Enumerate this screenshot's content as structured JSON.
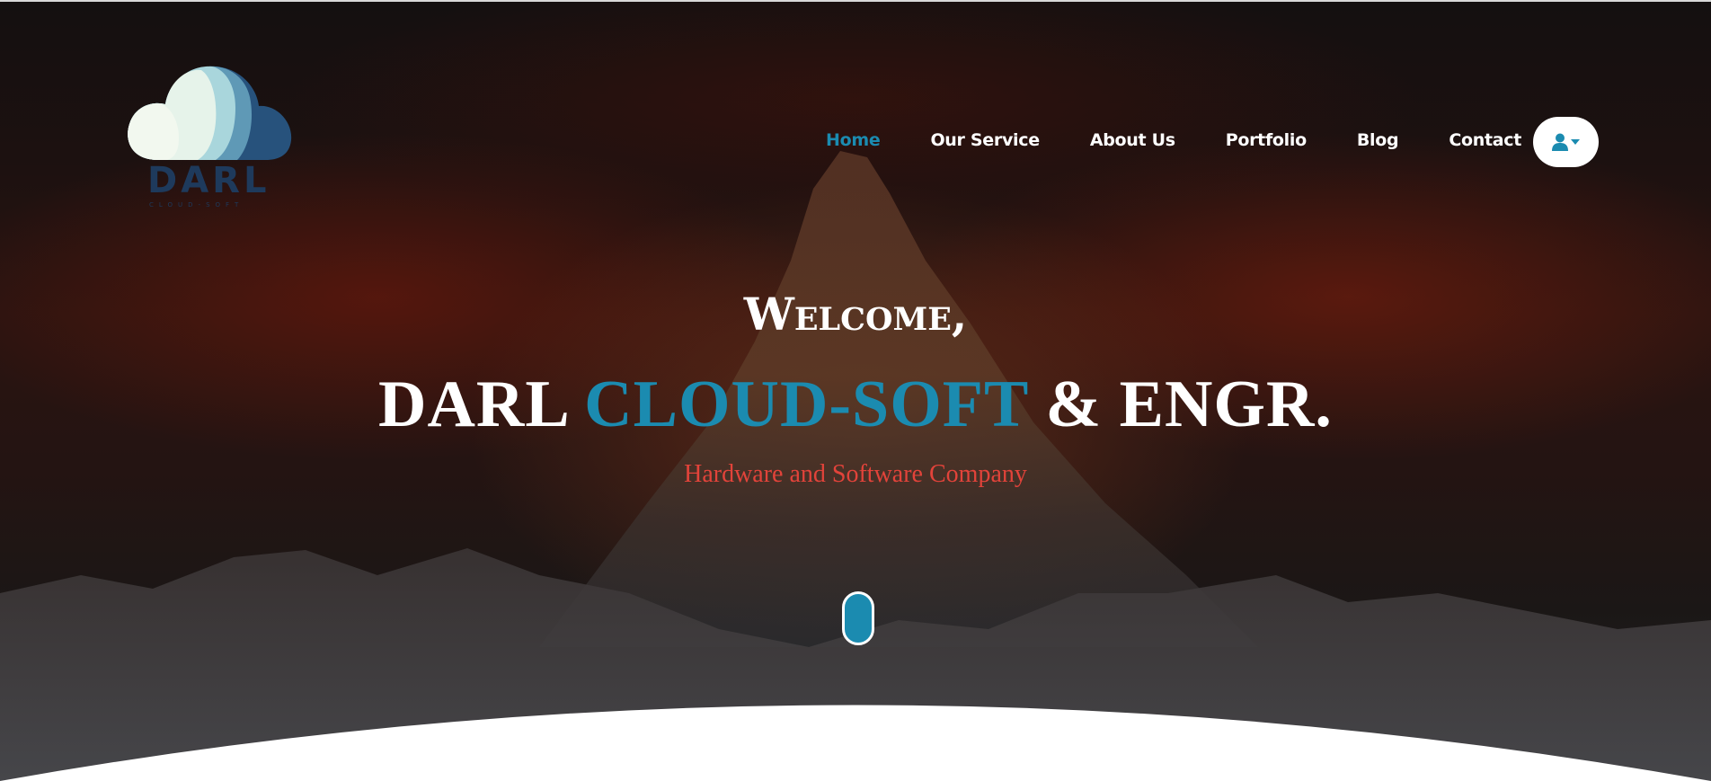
{
  "logo": {
    "word": "DARL",
    "subtitle": "CLOUD-SOFT"
  },
  "nav": {
    "items": [
      {
        "label": "Home",
        "active": true
      },
      {
        "label": "Our Service",
        "active": false
      },
      {
        "label": "About Us",
        "active": false
      },
      {
        "label": "Portfolio",
        "active": false
      },
      {
        "label": "Blog",
        "active": false
      },
      {
        "label": "Contact",
        "active": false
      }
    ],
    "user_menu_icon": "user-dropdown-icon"
  },
  "hero": {
    "welcome": "Welcome,",
    "headline_part1": "DARL",
    "headline_accent": "CLOUD-SOFT",
    "headline_part2": "& ENGR.",
    "tagline": "Hardware and Software Company",
    "scroll_icon": "mouse-scroll-icon"
  },
  "colors": {
    "accent": "#1b8bb0",
    "tagline": "#e2433a",
    "nav_text": "#ffffff",
    "logo_text": "#1e3a5c"
  }
}
